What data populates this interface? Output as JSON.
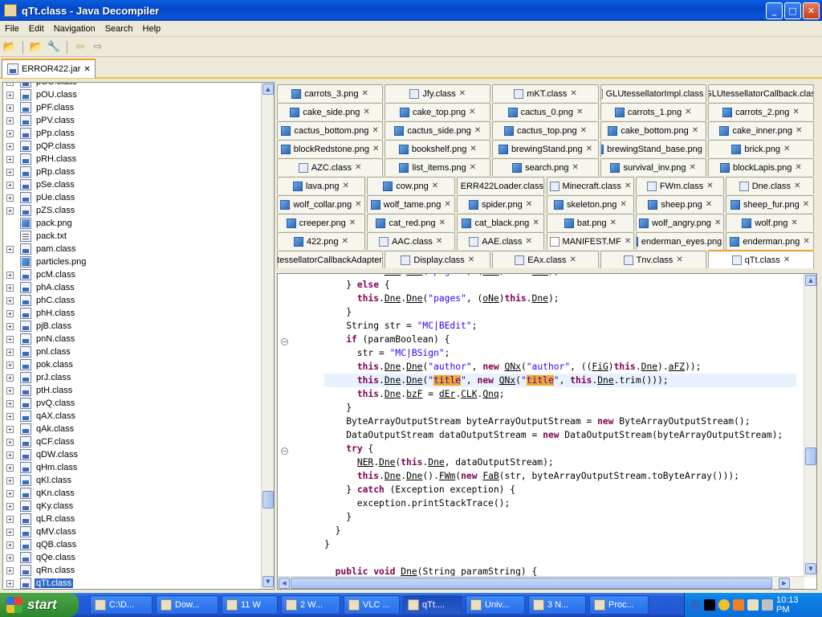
{
  "window": {
    "title": "qTt.class - Java Decompiler",
    "minimize": "_",
    "maximize": "□",
    "close": "✕"
  },
  "menu": [
    "File",
    "Edit",
    "Navigation",
    "Search",
    "Help"
  ],
  "toolbar": {
    "open_icon": "📂",
    "open_type_icon": "🔧",
    "back_icon": "⇦",
    "forward_icon": "⇨"
  },
  "jar_tab": {
    "label": "ERROR422.jar",
    "close": "✕"
  },
  "tree": {
    "items": [
      {
        "label": "pOU.class",
        "type": "class",
        "expandable": true,
        "selected": false
      },
      {
        "label": "pOU.class",
        "type": "class",
        "expandable": true,
        "selected": false
      },
      {
        "label": "pPF.class",
        "type": "class",
        "expandable": true,
        "selected": false
      },
      {
        "label": "pPV.class",
        "type": "class",
        "expandable": true,
        "selected": false
      },
      {
        "label": "pPp.class",
        "type": "class",
        "expandable": true,
        "selected": false
      },
      {
        "label": "pQP.class",
        "type": "class",
        "expandable": true,
        "selected": false
      },
      {
        "label": "pRH.class",
        "type": "class",
        "expandable": true,
        "selected": false
      },
      {
        "label": "pRp.class",
        "type": "class",
        "expandable": true,
        "selected": false
      },
      {
        "label": "pSe.class",
        "type": "class",
        "expandable": true,
        "selected": false
      },
      {
        "label": "pUe.class",
        "type": "class",
        "expandable": true,
        "selected": false
      },
      {
        "label": "pZS.class",
        "type": "class",
        "expandable": true,
        "selected": false
      },
      {
        "label": "pack.png",
        "type": "png",
        "expandable": false,
        "selected": false
      },
      {
        "label": "pack.txt",
        "type": "txt",
        "expandable": false,
        "selected": false
      },
      {
        "label": "pam.class",
        "type": "class",
        "expandable": true,
        "selected": false
      },
      {
        "label": "particles.png",
        "type": "png",
        "expandable": false,
        "selected": false
      },
      {
        "label": "pcM.class",
        "type": "class",
        "expandable": true,
        "selected": false
      },
      {
        "label": "phA.class",
        "type": "class",
        "expandable": true,
        "selected": false
      },
      {
        "label": "phC.class",
        "type": "class",
        "expandable": true,
        "selected": false
      },
      {
        "label": "phH.class",
        "type": "class",
        "expandable": true,
        "selected": false
      },
      {
        "label": "pjB.class",
        "type": "class",
        "expandable": true,
        "selected": false
      },
      {
        "label": "pnN.class",
        "type": "class",
        "expandable": true,
        "selected": false
      },
      {
        "label": "pnl.class",
        "type": "class",
        "expandable": true,
        "selected": false
      },
      {
        "label": "pok.class",
        "type": "class",
        "expandable": true,
        "selected": false
      },
      {
        "label": "prJ.class",
        "type": "class",
        "expandable": true,
        "selected": false
      },
      {
        "label": "ptH.class",
        "type": "class",
        "expandable": true,
        "selected": false
      },
      {
        "label": "pvQ.class",
        "type": "class",
        "expandable": true,
        "selected": false
      },
      {
        "label": "qAX.class",
        "type": "class",
        "expandable": true,
        "selected": false
      },
      {
        "label": "qAk.class",
        "type": "class",
        "expandable": true,
        "selected": false
      },
      {
        "label": "qCF.class",
        "type": "class",
        "expandable": true,
        "selected": false
      },
      {
        "label": "qDW.class",
        "type": "class",
        "expandable": true,
        "selected": false
      },
      {
        "label": "qHm.class",
        "type": "class",
        "expandable": true,
        "selected": false
      },
      {
        "label": "qKl.class",
        "type": "class",
        "expandable": true,
        "selected": false
      },
      {
        "label": "qKn.class",
        "type": "class",
        "expandable": true,
        "selected": false
      },
      {
        "label": "qKy.class",
        "type": "class",
        "expandable": true,
        "selected": false
      },
      {
        "label": "qLR.class",
        "type": "class",
        "expandable": true,
        "selected": false
      },
      {
        "label": "qMV.class",
        "type": "class",
        "expandable": true,
        "selected": false
      },
      {
        "label": "qQB.class",
        "type": "class",
        "expandable": true,
        "selected": false
      },
      {
        "label": "qQe.class",
        "type": "class",
        "expandable": true,
        "selected": false
      },
      {
        "label": "qRn.class",
        "type": "class",
        "expandable": true,
        "selected": false
      },
      {
        "label": "qTt.class",
        "type": "class",
        "expandable": true,
        "selected": true
      }
    ]
  },
  "file_tabs": [
    [
      {
        "label": "carrots_3.png",
        "icon": "png"
      },
      {
        "label": "Jfy.class",
        "icon": "class"
      },
      {
        "label": "mKT.class",
        "icon": "class"
      },
      {
        "label": "GLUtessellatorImpl.class",
        "icon": "class"
      },
      {
        "label": "GLUtessellatorCallback.class",
        "icon": "class"
      }
    ],
    [
      {
        "label": "cake_side.png",
        "icon": "png"
      },
      {
        "label": "cake_top.png",
        "icon": "png"
      },
      {
        "label": "cactus_0.png",
        "icon": "png"
      },
      {
        "label": "carrots_1.png",
        "icon": "png"
      },
      {
        "label": "carrots_2.png",
        "icon": "png"
      }
    ],
    [
      {
        "label": "cactus_bottom.png",
        "icon": "png"
      },
      {
        "label": "cactus_side.png",
        "icon": "png"
      },
      {
        "label": "cactus_top.png",
        "icon": "png"
      },
      {
        "label": "cake_bottom.png",
        "icon": "png"
      },
      {
        "label": "cake_inner.png",
        "icon": "png"
      }
    ],
    [
      {
        "label": "blockRedstone.png",
        "icon": "png"
      },
      {
        "label": "bookshelf.png",
        "icon": "png"
      },
      {
        "label": "brewingStand.png",
        "icon": "png"
      },
      {
        "label": "brewingStand_base.png",
        "icon": "png"
      },
      {
        "label": "brick.png",
        "icon": "png"
      }
    ],
    [
      {
        "label": "AZC.class",
        "icon": "class"
      },
      {
        "label": "list_items.png",
        "icon": "png"
      },
      {
        "label": "search.png",
        "icon": "png"
      },
      {
        "label": "survival_inv.png",
        "icon": "png"
      },
      {
        "label": "blockLapis.png",
        "icon": "png"
      }
    ],
    [
      {
        "label": "lava.png",
        "icon": "png"
      },
      {
        "label": "cow.png",
        "icon": "png"
      },
      {
        "label": "ERR422Loader.class",
        "icon": "class"
      },
      {
        "label": "Minecraft.class",
        "icon": "class"
      },
      {
        "label": "FWm.class",
        "icon": "class"
      },
      {
        "label": "Dne.class",
        "icon": "class"
      }
    ],
    [
      {
        "label": "wolf_collar.png",
        "icon": "png"
      },
      {
        "label": "wolf_tame.png",
        "icon": "png"
      },
      {
        "label": "spider.png",
        "icon": "png"
      },
      {
        "label": "skeleton.png",
        "icon": "png"
      },
      {
        "label": "sheep.png",
        "icon": "png"
      },
      {
        "label": "sheep_fur.png",
        "icon": "png"
      }
    ],
    [
      {
        "label": "creeper.png",
        "icon": "png"
      },
      {
        "label": "cat_red.png",
        "icon": "png"
      },
      {
        "label": "cat_black.png",
        "icon": "png"
      },
      {
        "label": "bat.png",
        "icon": "png"
      },
      {
        "label": "wolf_angry.png",
        "icon": "png"
      },
      {
        "label": "wolf.png",
        "icon": "png"
      }
    ],
    [
      {
        "label": "422.png",
        "icon": "png"
      },
      {
        "label": "AAC.class",
        "icon": "class"
      },
      {
        "label": "AAE.class",
        "icon": "class"
      },
      {
        "label": "MANIFEST.MF",
        "icon": "mf"
      },
      {
        "label": "enderman_eyes.png",
        "icon": "png"
      },
      {
        "label": "enderman.png",
        "icon": "png"
      }
    ],
    [
      {
        "label": "GLUtessellatorCallbackAdapter.class",
        "icon": "class"
      },
      {
        "label": "Display.class",
        "icon": "class"
      },
      {
        "label": "EAx.class",
        "icon": "class"
      },
      {
        "label": "Tnv.class",
        "icon": "class"
      },
      {
        "label": "qTt.class",
        "icon": "class",
        "active": true
      }
    ]
  ],
  "code": {
    "lines": [
      "      this.Dne.Dne(\"pages\", (oNe)this.Dne);",
      "    } else {",
      "      this.Dne.Dne(\"pages\", (oNe)this.Dne);",
      "    }",
      "    String str = \"MC|BEdit\";",
      "    if (paramBoolean) {",
      "      str = \"MC|BSign\";",
      "      this.Dne.Dne(\"author\", new QNx(\"author\", ((FiG)this.Dne).aFZ));",
      "      this.Dne.Dne(\"title\", new QNx(\"title\", this.Dne.trim()));",
      "      this.Dne.bzF = dEr.CLK.Qnq;",
      "    }",
      "    ByteArrayOutputStream byteArrayOutputStream = new ByteArrayOutputStream();",
      "    DataOutputStream dataOutputStream = new DataOutputStream(byteArrayOutputStream);",
      "    try {",
      "      NER.Dne(this.Dne, dataOutputStream);",
      "      this.Dne.Dne().FWm(new FaB(str, byteArrayOutputStream.toByteArray()));",
      "    } catch (Exception exception) {",
      "      exception.printStackTrace();",
      "    }",
      "  }",
      "}",
      "",
      "  public void Dne(String paramString) {"
    ],
    "highlighted_line": 8
  },
  "taskbar": {
    "start": "start",
    "tasks": [
      "C:\\D...",
      "Dow...",
      "11 W",
      "2 W...",
      "VLC ...",
      "qTt....",
      "Univ...",
      "3 N...",
      "Proc..."
    ],
    "clock": "10:13 PM"
  }
}
